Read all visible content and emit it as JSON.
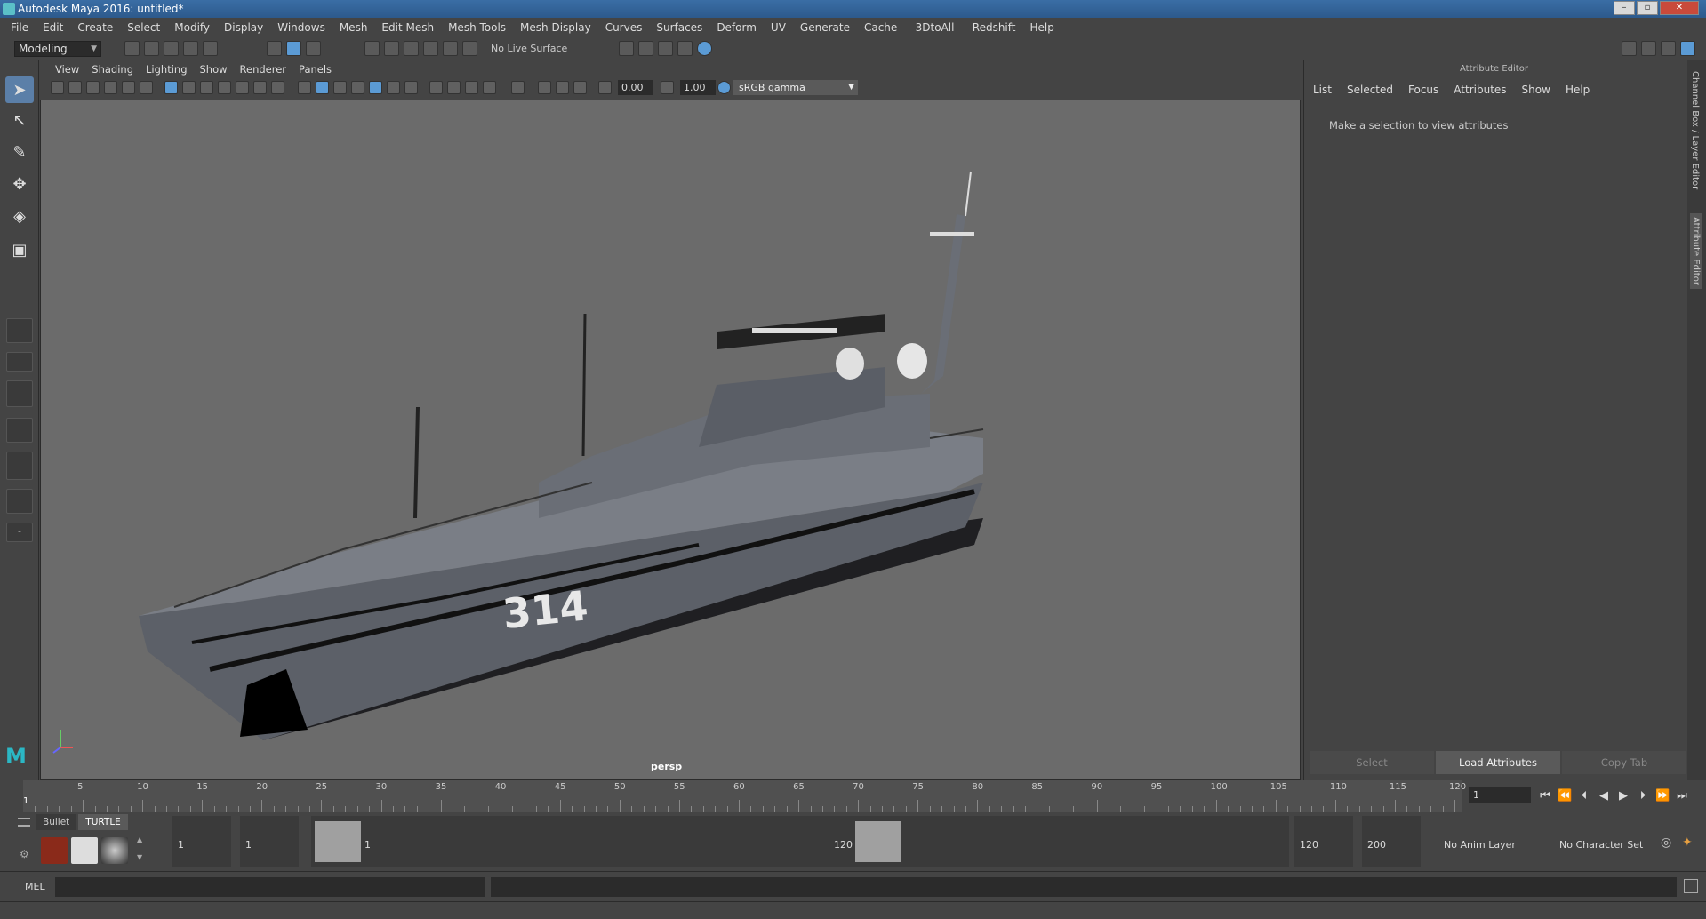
{
  "window": {
    "title": "Autodesk Maya 2016: untitled*"
  },
  "menubar": [
    "File",
    "Edit",
    "Create",
    "Select",
    "Modify",
    "Display",
    "Windows",
    "Mesh",
    "Edit Mesh",
    "Mesh Tools",
    "Mesh Display",
    "Curves",
    "Surfaces",
    "Deform",
    "UV",
    "Generate",
    "Cache",
    "-3DtoAll-",
    "Redshift",
    "Help"
  ],
  "statusline": {
    "mode": "Modeling",
    "live_surface": "No Live Surface"
  },
  "viewport": {
    "menu": [
      "View",
      "Shading",
      "Lighting",
      "Show",
      "Renderer",
      "Panels"
    ],
    "exposure": "0.00",
    "gamma_value": "1.00",
    "color_space": "sRGB gamma",
    "camera_label": "persp",
    "hull_number": "314"
  },
  "attribute_editor": {
    "title": "Attribute Editor",
    "menu": [
      "List",
      "Selected",
      "Focus",
      "Attributes",
      "Show",
      "Help"
    ],
    "message": "Make a selection to view attributes",
    "buttons": {
      "select": "Select",
      "load": "Load Attributes",
      "copy": "Copy Tab"
    },
    "vertical_tabs": {
      "channel_box": "Channel Box / Layer Editor",
      "attr_editor": "Attribute Editor"
    }
  },
  "timeslider": {
    "ticks": [
      "5",
      "10",
      "15",
      "20",
      "25",
      "30",
      "35",
      "40",
      "45",
      "50",
      "55",
      "60",
      "65",
      "70",
      "75",
      "80",
      "85",
      "90",
      "95",
      "100",
      "105",
      "110",
      "115",
      "120"
    ],
    "start_label": "1",
    "current_frame": "1"
  },
  "rangeslider": {
    "shelf_tabs": [
      "Bullet",
      "TURTLE"
    ],
    "start_time": "1",
    "playback_start": "1",
    "range_start_label": "1",
    "range_end_label": "120",
    "playback_end": "120",
    "end_time": "200",
    "anim_layer": "No Anim Layer",
    "character_set": "No Character Set"
  },
  "cmdline": {
    "label": "MEL"
  }
}
